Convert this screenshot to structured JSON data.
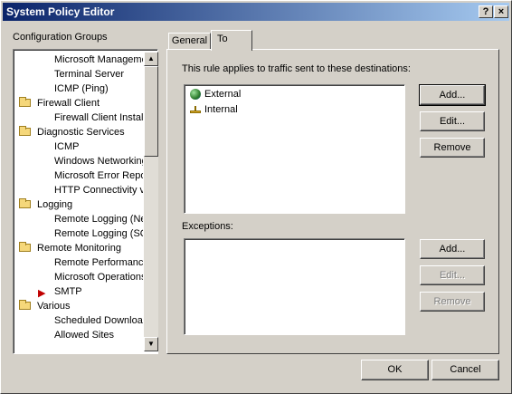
{
  "window": {
    "title": "System Policy Editor",
    "help_button": "?",
    "close_button": "×"
  },
  "tree": {
    "heading": "Configuration Groups",
    "items": [
      {
        "label": "Microsoft Management",
        "level": 1
      },
      {
        "label": "Terminal Server",
        "level": 1
      },
      {
        "label": "ICMP (Ping)",
        "level": 1
      },
      {
        "label": "Firewall Client",
        "level": 0
      },
      {
        "label": "Firewall Client Installation",
        "level": 1
      },
      {
        "label": "Diagnostic Services",
        "level": 0
      },
      {
        "label": "ICMP",
        "level": 1
      },
      {
        "label": "Windows Networking",
        "level": 1
      },
      {
        "label": "Microsoft Error Reporting",
        "level": 1
      },
      {
        "label": "HTTP Connectivity verifiers",
        "level": 1
      },
      {
        "label": "Logging",
        "level": 0
      },
      {
        "label": "Remote Logging (NetBIOS)",
        "level": 1
      },
      {
        "label": "Remote Logging (SQL)",
        "level": 1
      },
      {
        "label": "Remote Monitoring",
        "level": 0
      },
      {
        "label": "Remote Performance Monitoring",
        "level": 1
      },
      {
        "label": "Microsoft Operations Manager",
        "level": 1
      },
      {
        "label": "SMTP",
        "level": 1,
        "marked": true
      },
      {
        "label": "Various",
        "level": 0
      },
      {
        "label": "Scheduled Download Jobs",
        "level": 1
      },
      {
        "label": "Allowed Sites",
        "level": 1
      }
    ]
  },
  "tabs": {
    "general": "General",
    "to": "To",
    "active": "To"
  },
  "to_tab": {
    "description": "This rule applies to traffic sent to these destinations:",
    "destinations": [
      {
        "label": "External",
        "icon": "globe-icon"
      },
      {
        "label": "Internal",
        "icon": "network-icon"
      }
    ],
    "exceptions_label": "Exceptions:",
    "buttons": {
      "add": "Add...",
      "edit": "Edit...",
      "remove": "Remove",
      "add2": "Add...",
      "edit2": "Edit...",
      "remove2": "Remove"
    }
  },
  "footer": {
    "ok": "OK",
    "cancel": "Cancel"
  }
}
